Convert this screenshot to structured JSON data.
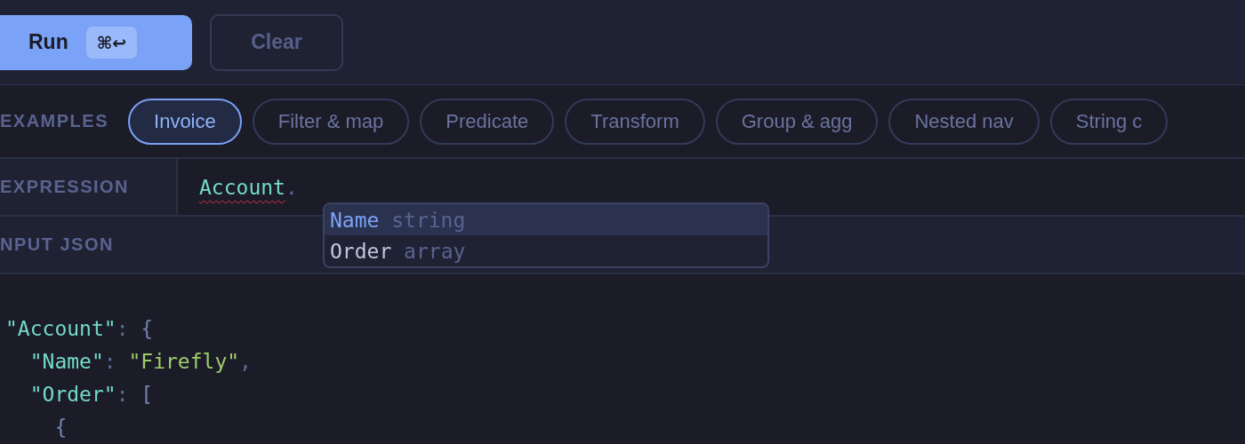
{
  "toolbar": {
    "run_button": {
      "label": "Run",
      "shortcut": "⌘↩"
    },
    "clear_button": {
      "label": "Clear"
    }
  },
  "examples": {
    "label": "EXAMPLES",
    "chips": [
      {
        "label": "Invoice",
        "selected": true
      },
      {
        "label": "Filter & map",
        "selected": false
      },
      {
        "label": "Predicate",
        "selected": false
      },
      {
        "label": "Transform",
        "selected": false
      },
      {
        "label": "Group & agg",
        "selected": false
      },
      {
        "label": "Nested nav",
        "selected": false
      },
      {
        "label": "String c",
        "selected": false
      }
    ]
  },
  "expression": {
    "label": "EXPRESSION",
    "tokens": [
      {
        "text": "Account",
        "kind": "field",
        "error": true
      },
      {
        "text": ".",
        "kind": "punct"
      }
    ],
    "autocomplete": [
      {
        "name": "Name",
        "type": "string",
        "selected": true
      },
      {
        "name": "Order",
        "type": "array",
        "selected": false
      }
    ]
  },
  "input_json": {
    "label": "NPUT JSON",
    "lines": [
      {
        "tokens": [
          {
            "text": "\"Account\"",
            "kind": "key"
          },
          {
            "text": ": ",
            "kind": "punct"
          },
          {
            "text": "{",
            "kind": "bracket"
          }
        ],
        "children": [
          {
            "tokens": [
              {
                "text": "\"Name\"",
                "kind": "key"
              },
              {
                "text": ": ",
                "kind": "punct"
              },
              {
                "text": "\"Firefly\"",
                "kind": "string"
              },
              {
                "text": ",",
                "kind": "punct"
              }
            ]
          },
          {
            "tokens": [
              {
                "text": "\"Order\"",
                "kind": "key"
              },
              {
                "text": ": ",
                "kind": "punct"
              },
              {
                "text": "[",
                "kind": "bracket"
              }
            ],
            "children": [
              {
                "tokens": [
                  {
                    "text": "{",
                    "kind": "bracket"
                  }
                ]
              }
            ]
          }
        ]
      }
    ]
  }
}
